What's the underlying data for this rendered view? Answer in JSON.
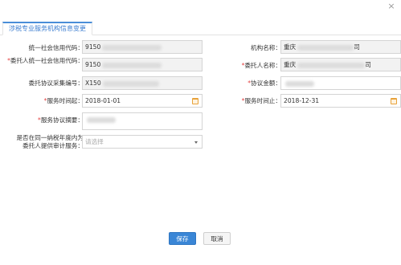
{
  "dialog": {
    "close_glyph": "×"
  },
  "tab": {
    "label": "涉税专业服务机构信息变更"
  },
  "form": {
    "unified_credit_code": {
      "label": "统一社会信用代码：",
      "value": "9150"
    },
    "org_name": {
      "label": "机构名称：",
      "value": "重庆",
      "tail": "司"
    },
    "client_credit_code": {
      "req": "*",
      "label": "委托人统一社会信用代码：",
      "value": "9150"
    },
    "client_name": {
      "req": "*",
      "label": "委托人名称：",
      "value": "重庆",
      "tail": "司"
    },
    "agreement_no": {
      "label": "委托协议采集编号：",
      "value": "X150"
    },
    "agreement_amount": {
      "req": "*",
      "label": "协议金额：",
      "value": ""
    },
    "service_start": {
      "req": "*",
      "label": "服务时间起：",
      "value": "2018-01-01"
    },
    "service_end": {
      "req": "*",
      "label": "服务时间止：",
      "value": "2018-12-31"
    },
    "summary": {
      "req": "*",
      "label": "服务协议摘要：",
      "value": ""
    },
    "audit_service": {
      "label_line1": "是否在同一纳税年度内为",
      "label_line2": "委托人提供审计服务：",
      "placeholder": "请选择"
    }
  },
  "buttons": {
    "save": "保存",
    "cancel": "取消"
  },
  "colors": {
    "accent": "#3a86d6",
    "required": "#e23b3b",
    "calendar": "#e8a23a"
  },
  "icons": [
    "close-icon",
    "calendar-icon",
    "chevron-down-icon"
  ]
}
